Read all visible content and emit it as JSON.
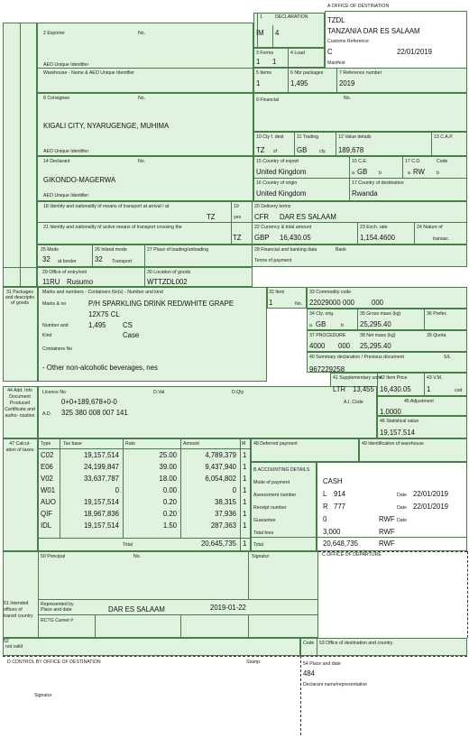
{
  "header": {
    "office_dest": "A OFFICE OF DESTINATION",
    "declaration": "DECLARATION",
    "decl_type": "IM",
    "decl_num": "4",
    "office_code": "TZDL",
    "office_name": "TANZANIA DAR ES SALAAM",
    "customs_ref": "Customs Reference",
    "ref_c": "C",
    "ref_date": "22/01/2019",
    "manifest": "Manifest"
  },
  "forms": {
    "l3": "3 Forms",
    "v3a": "1",
    "v3b": "1",
    "l4": "4 Load"
  },
  "items": {
    "l5": "5 Items",
    "v5": "1",
    "l6": "6 Nbr packages",
    "v6": "1,495",
    "l7": "7 Reference number",
    "v7": "2019"
  },
  "exporter": {
    "label": "2 Exporter",
    "no": "No.",
    "aeo": "AEO Unique Identifier",
    "warehouse": "Warehouse - Name & AEO Unique Identifier"
  },
  "consignee": {
    "label": "8 Consignee",
    "no": "No.",
    "addr": "KIGALI CITY, NYARUGENGE, MUHIMA",
    "aeo": "AEO Unique Identifier"
  },
  "financial": {
    "label": "9 Financial",
    "no": "No."
  },
  "box10": {
    "l10": "10 Cty f. dest",
    "l11": "11 Trading",
    "l12": "12 Value details",
    "l13": "13 C.A.P.",
    "tz": "TZ",
    "gb": "GB",
    "v12": "189,678",
    "sf": "sf",
    "cty": "cty."
  },
  "declarant": {
    "label": "14 Declarant",
    "no": "No.",
    "name": "GIKONDO-MAGERWA",
    "aeo": "AEO Unique Identifier"
  },
  "export": {
    "l15": "15 Country of export",
    "v15": "United Kingdom",
    "l15ce": "15 C.E.",
    "l17cd": "17 C.D.",
    "code": "Code",
    "a": "a",
    "b": "b",
    "gb": "GB",
    "rw": "RW",
    "l16": "16 Country of origin",
    "v16": "United Kingdom",
    "l17": "17 Country of destination",
    "v17": "Rwanda"
  },
  "transport": {
    "l18": "18 Identity and nationality of means of transport at arrival / at",
    "tz18": "TZ",
    "l19": "19",
    "v19": "yes",
    "l20": "20 Delivery terms",
    "v20a": "CFR",
    "v20b": "DAR ES SALAAM",
    "l21": "21 Identity and nationality of active means of transport crossing the",
    "tz21": "TZ",
    "l22": "22 Currency & total amount",
    "v22a": "GBP",
    "v22b": "16,430.05",
    "l23": "23 Exch. rate",
    "v23": "1,154.4600",
    "l24": "24 Nature of",
    "transac": "transac."
  },
  "mode": {
    "l25": "25 Mode",
    "v25": "32",
    "at_border": "at border",
    "l26": "26 Inland mode",
    "v26": "32",
    "transport": "Transport",
    "l27": "27 Place of loading/unloading",
    "l28": "28 Financial and banking data",
    "bank": "Bank",
    "terms": "Terms of payment",
    "l29": "29 Office of entry/exit",
    "v29a": "11RU",
    "v29b": "Rusumo",
    "l30": "30 Location of goods",
    "v30": "WTTZDL002"
  },
  "goods": {
    "l31": "31 Packages and descriptio of goods",
    "marks_label": "Marks and numbers - Containers No(s) - Number and kind",
    "marks_no": "Marks & no",
    "desc1": "P/H SPARKLING DRINK RED/WHITE GRAPE",
    "desc2": "12X75 CL",
    "num_kind": "Number and",
    "kind": "Kind",
    "qty": "1,495",
    "cs": "CS",
    "case": "Case",
    "containers": "Containers No",
    "desc_full": "- Other non-alcoholic beverages, nes",
    "l32": "32 Item",
    "v32": "1",
    "no": "No.",
    "l33": "33 Commodity code",
    "v33a": "22029000",
    "v33b": "000",
    "v33c": "000",
    "l34": "34 Cty. orig.",
    "a": "a",
    "v34": "GB",
    "b": "b",
    "l35": "35 Gross mass (kg)",
    "v35": "25,295.40",
    "l36": "36 Prefer.",
    "l37": "37 PROCEDURE",
    "v37a": "4000",
    "v37b": "000",
    "l38": "38 Net mass (kg)",
    "v38": "25,295.40",
    "l39": "39 Quota",
    "l40": "40 Summary declaration / Previous document",
    "v40": "967229258",
    "sl": "S/L",
    "l41": "41 Supplementary units",
    "v41a": "LTR",
    "v41b": "13,455",
    "l42": "42 Item Price",
    "v42": "16,430.05",
    "l43": "43 V.M.",
    "v43a": "1",
    "v43b": "cod"
  },
  "add_info": {
    "l44": "44 Add. Info Document Produced Certificate and autho- rization",
    "licence": "Licence No",
    "dval": "D.Val",
    "dqty": "D.Qty",
    "formula": "0+0+189,678+0-0",
    "ad": "A.D.",
    "ad_val": "325 380 008 007 141",
    "ai_code": "A.I. Code",
    "l45": "45 Adjustment",
    "v45": "1.0000",
    "l46": "46 Statistical value",
    "v46": "19,157,514"
  },
  "taxes": {
    "l47": "47 Calcul- ation of taxes",
    "headers": [
      "Type",
      "Tax base",
      "Rate",
      "Amount",
      "M"
    ],
    "rows": [
      [
        "C02",
        "19,157,514",
        "25.00",
        "4,789,379",
        "1"
      ],
      [
        "E06",
        "24,199,847",
        "39.00",
        "9,437,940",
        "1"
      ],
      [
        "V02",
        "33,637,787",
        "18.00",
        "6,054,802",
        "1"
      ],
      [
        "W01",
        "0",
        "0.00",
        "0",
        "1"
      ],
      [
        "AUO",
        "19,157,514",
        "0.20",
        "38,315",
        "1"
      ],
      [
        "QIF",
        "18,967,836",
        "0.20",
        "37,936",
        "1"
      ],
      [
        "IDL",
        "19,157,514",
        "1.50",
        "287,363",
        "1"
      ]
    ],
    "total_label": "Total",
    "total": "20,645,735",
    "total_m": "1"
  },
  "l48": "48 Deferred payment",
  "l49": "49 Identification of warehouse",
  "accounting": {
    "label": "B ACCOUNTING DETAILS",
    "mode_label": "Mode of payment",
    "mode": "CASH",
    "assess_label": "Assessment number",
    "assess_l": "L",
    "assess_n": "914",
    "date": "Date",
    "assess_date": "22/01/2019",
    "receipt_label": "Receipt number",
    "receipt_r": "R",
    "receipt_n": "777",
    "receipt_date": "22/01/2019",
    "guar_label": "Guarantee",
    "guar": "0",
    "rwf": "RWF",
    "fees_label": "Total fees",
    "fees": "3,000",
    "total_label": "Total",
    "total": "20,648,735"
  },
  "principal": {
    "l50": "50 Principal",
    "no": "No.",
    "signature": "Signatur",
    "c_office": "C OFFICE OF DEPARTURE",
    "l51": "51 Intended offices of transit country",
    "rep": "Represented by",
    "place_date": "Place and date",
    "place": "DAR ES SALAAM",
    "date": "2019-01-22",
    "rctg": "RCTG Carnet #"
  },
  "footer": {
    "l52": "52",
    "not_valid": "not valid",
    "code": "Code",
    "l53": "53 Office of destination and country",
    "d_control": "D CONTROL BY OFFICE OF DESTINATION",
    "stamp": "Stamp:",
    "l54": "54 Place and date",
    "v54": "484",
    "decl_name": "Declarant name/representative",
    "signature": "Signatur"
  }
}
